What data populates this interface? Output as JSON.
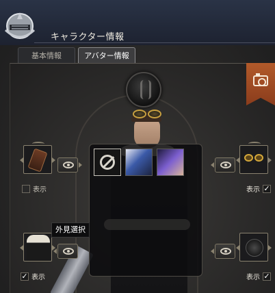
{
  "window": {
    "title": "キャラクター情報"
  },
  "tabs": [
    {
      "label": "基本情報",
      "active": false
    },
    {
      "label": "アバター情報",
      "active": true
    }
  ],
  "slots": {
    "left_top": {
      "item": "bag-icon",
      "checkbox_label": "表示",
      "checked": false
    },
    "right_top": {
      "item": "goggles-icon",
      "checkbox_label": "表示",
      "checked": true
    },
    "left_bottom": {
      "item": "coat-icon",
      "checkbox_label": "表示",
      "checked": true
    },
    "right_bottom": {
      "item": "rose-icon",
      "checkbox_label": "表示",
      "checked": true
    }
  },
  "tooltip": {
    "text": "外見選択"
  },
  "outfit_picker": {
    "options": [
      {
        "name": "none-option",
        "icon": "prohibited-icon"
      },
      {
        "name": "outfit-option-1",
        "icon": "costume-icon"
      },
      {
        "name": "outfit-option-2",
        "icon": "costume-icon"
      }
    ]
  },
  "colors": {
    "accent": "#b25a2a",
    "header": "#1d2230",
    "panel": "#2c2b2a"
  }
}
